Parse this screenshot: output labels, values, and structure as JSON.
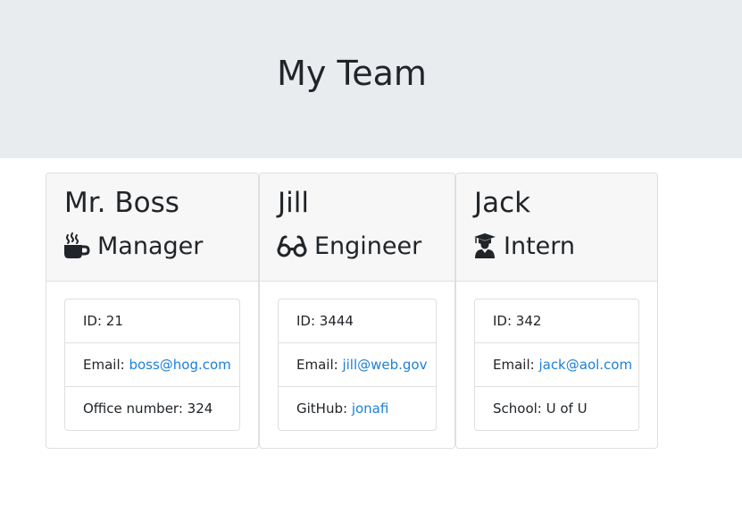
{
  "header": {
    "title": "My Team"
  },
  "cards": [
    {
      "name": "Mr. Boss",
      "role": "Manager",
      "role_icon": "coffee-mug-icon",
      "items": [
        {
          "label": "ID: ",
          "value": "21"
        },
        {
          "label": "Email: ",
          "value": "boss@hog.com"
        },
        {
          "label": "Office number: ",
          "value": "324"
        }
      ]
    },
    {
      "name": "Jill",
      "role": "Engineer",
      "role_icon": "glasses-icon",
      "items": [
        {
          "label": "ID: ",
          "value": "3444"
        },
        {
          "label": "Email: ",
          "value": "jill@web.gov"
        },
        {
          "label": "GitHub: ",
          "value": "jonafi"
        }
      ]
    },
    {
      "name": "Jack",
      "role": "Intern",
      "role_icon": "graduate-icon",
      "items": [
        {
          "label": "ID: ",
          "value": "342"
        },
        {
          "label": "Email: ",
          "value": "jack@aol.com"
        },
        {
          "label": "School: ",
          "value": "U of U"
        }
      ]
    }
  ],
  "colors": {
    "jumbotron_bg": "#e9ecef",
    "card_header_bg": "#f7f7f7",
    "link": "#1e7fd6",
    "text": "#212529"
  }
}
